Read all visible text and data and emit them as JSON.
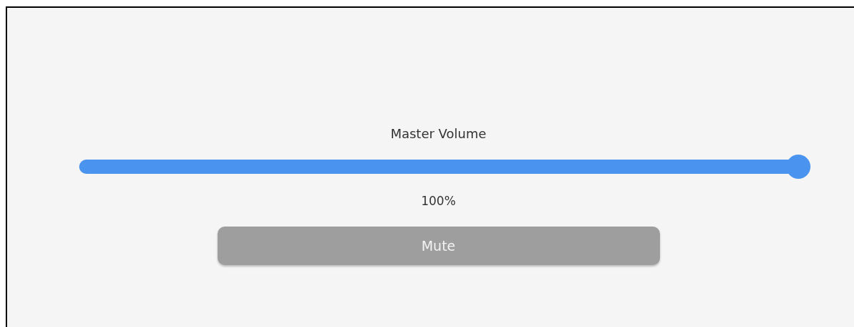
{
  "volume": {
    "label": "Master Volume",
    "level": 1,
    "reading": "100%"
  },
  "mute_button": {
    "label": "Mute"
  }
}
